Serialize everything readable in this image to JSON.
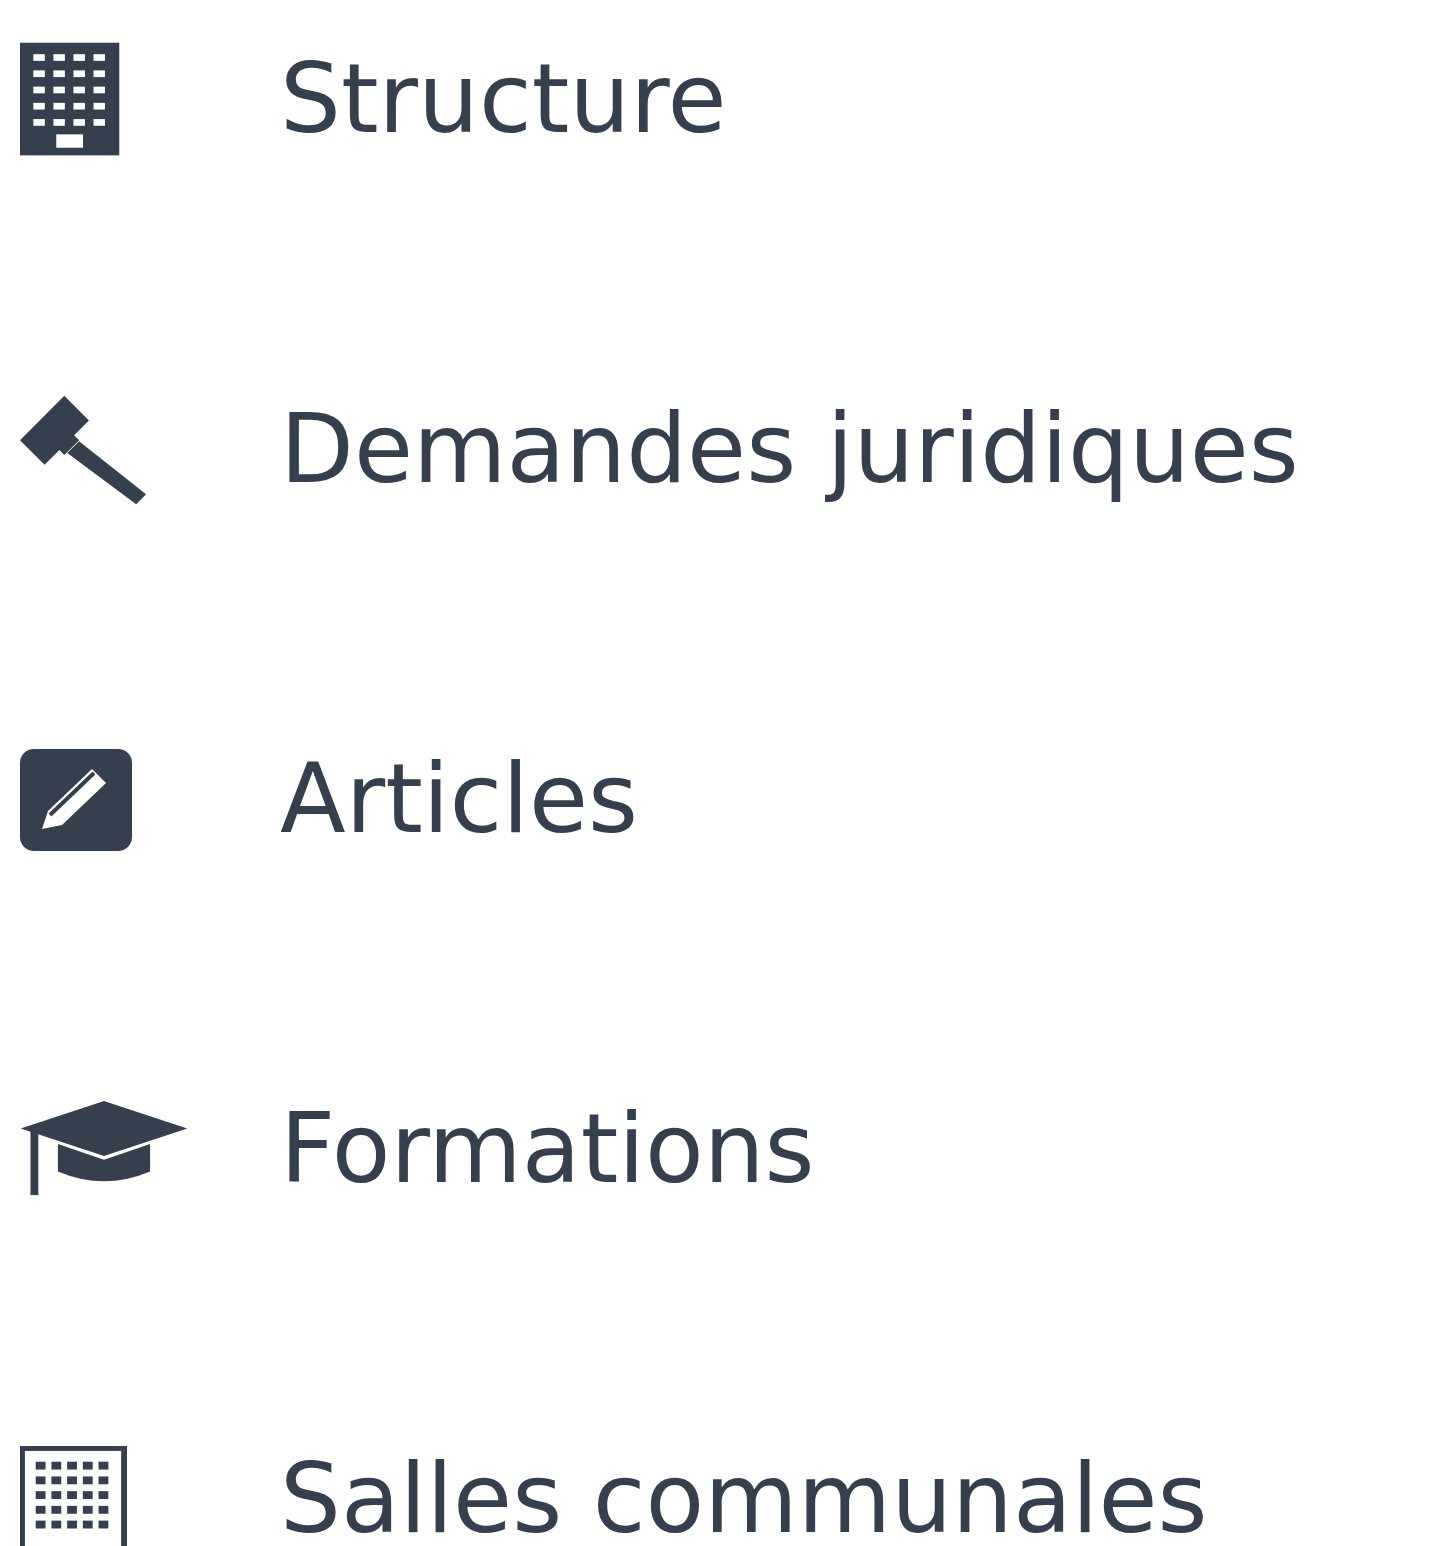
{
  "menu": {
    "items": [
      {
        "label": "Structure"
      },
      {
        "label": "Demandes juridiques"
      },
      {
        "label": "Articles"
      },
      {
        "label": "Formations"
      },
      {
        "label": "Salles communales"
      }
    ]
  }
}
